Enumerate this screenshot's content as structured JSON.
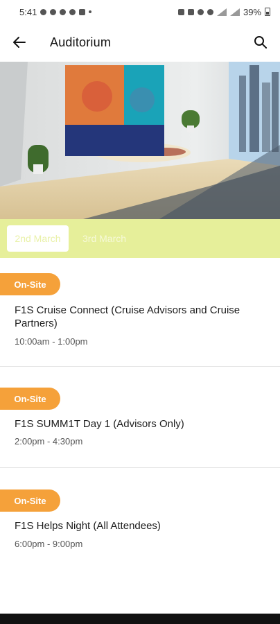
{
  "status_bar": {
    "time": "5:41",
    "battery": "39%"
  },
  "app_bar": {
    "title": "Auditorium",
    "back_icon": "arrow-left-icon",
    "search_icon": "search-icon"
  },
  "date_tabs": [
    {
      "label": "2nd March",
      "selected": true
    },
    {
      "label": "3rd March",
      "selected": false
    }
  ],
  "sessions": [
    {
      "badge": "On-Site",
      "title": "F1S Cruise Connect (Cruise Advisors and Cruise Partners)",
      "time": "10:00am - 1:00pm"
    },
    {
      "badge": "On-Site",
      "title": "F1S SUMM1T Day 1 (Advisors Only)",
      "time": "2:00pm - 4:30pm"
    },
    {
      "badge": "On-Site",
      "title": "F1S Helps Night (All Attendees)",
      "time": "6:00pm - 9:00pm"
    }
  ],
  "colors": {
    "accent": "#f5a13a",
    "tab_bar": "#e6ef9a"
  }
}
